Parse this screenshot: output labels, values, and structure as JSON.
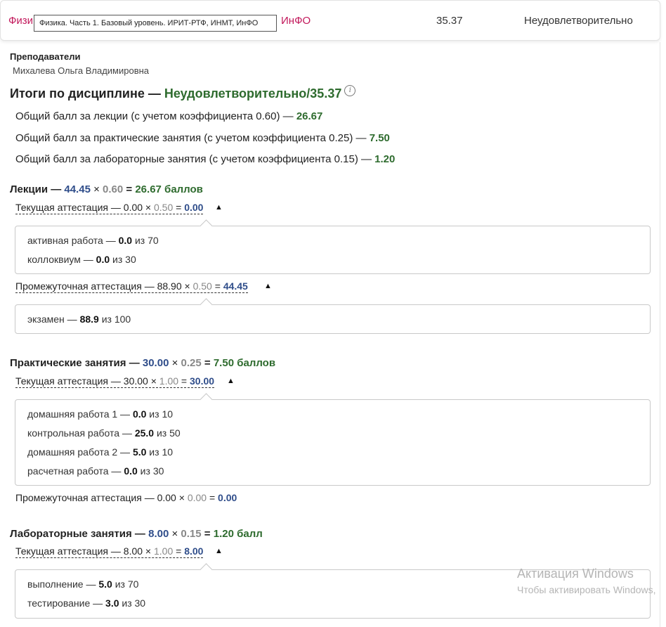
{
  "subject": {
    "name_start": "Физи",
    "name_end": "ИнФО",
    "tooltip": "Физика. Часть 1. Базовый уровень. ИРИТ-РТФ, ИНМТ, ИнФО",
    "score": "35.37",
    "grade": "Неудовлетворительно"
  },
  "teachers": {
    "title": "Преподаватели",
    "name": "Михалева Ольга Владимировна"
  },
  "totals": {
    "prefix": "Итоги по дисциплине — ",
    "result": "Неудовлетворительно/35.37",
    "lines": [
      {
        "label": "Общий балл за лекции (с учетом коэффициента 0.60) — ",
        "value": "26.67"
      },
      {
        "label": "Общий балл за практические занятия (с учетом коэффициента 0.25) — ",
        "value": "7.50"
      },
      {
        "label": "Общий балл за лабораторные занятия (с учетом коэффициента 0.15) — ",
        "value": "1.20"
      }
    ]
  },
  "sections": [
    {
      "name": "Лекции — ",
      "score": "44.45",
      "coef": "0.60",
      "result": "26.67 баллов",
      "current": {
        "label": "Текущая аттестация — 0.00 × ",
        "coef": "0.50",
        "result": "0.00",
        "items": [
          {
            "label": "активная работа — ",
            "value": "0.0",
            "max": " из 70"
          },
          {
            "label": "коллоквиум — ",
            "value": "0.0",
            "max": " из 30"
          }
        ]
      },
      "intermediate": {
        "label": "Промежуточная аттестация — 88.90 × ",
        "coef": "0.50",
        "result": "44.45",
        "items": [
          {
            "label": "экзамен — ",
            "value": "88.9",
            "max": " из 100"
          }
        ]
      }
    },
    {
      "name": "Практические занятия — ",
      "score": "30.00",
      "coef": "0.25",
      "result": "7.50 баллов",
      "current": {
        "label": "Текущая аттестация — 30.00 × ",
        "coef": "1.00",
        "result": "30.00",
        "items": [
          {
            "label": "домашняя работа 1 — ",
            "value": "0.0",
            "max": " из 10"
          },
          {
            "label": "контрольная работа — ",
            "value": "25.0",
            "max": " из 50"
          },
          {
            "label": "домашняя работа 2 — ",
            "value": "5.0",
            "max": " из 10"
          },
          {
            "label": "расчетная работа — ",
            "value": "0.0",
            "max": " из 30"
          }
        ]
      },
      "intermediate": {
        "label": "Промежуточная аттестация — 0.00 × ",
        "coef": "0.00",
        "result": "0.00"
      }
    },
    {
      "name": "Лабораторные занятия — ",
      "score": "8.00",
      "coef": "0.15",
      "result": "1.20 балл",
      "current": {
        "label": "Текущая аттестация — 8.00 × ",
        "coef": "1.00",
        "result": "8.00",
        "items": [
          {
            "label": "выполнение — ",
            "value": "5.0",
            "max": " из 70"
          },
          {
            "label": "тестирование — ",
            "value": "3.0",
            "max": " из 30"
          }
        ]
      }
    }
  ],
  "symbols": {
    "times": " × ",
    "equals": " = ",
    "caret": "▲",
    "info": "i"
  },
  "watermark": {
    "line1": "Активация Windows",
    "line2": "Чтобы активировать Windows,"
  }
}
